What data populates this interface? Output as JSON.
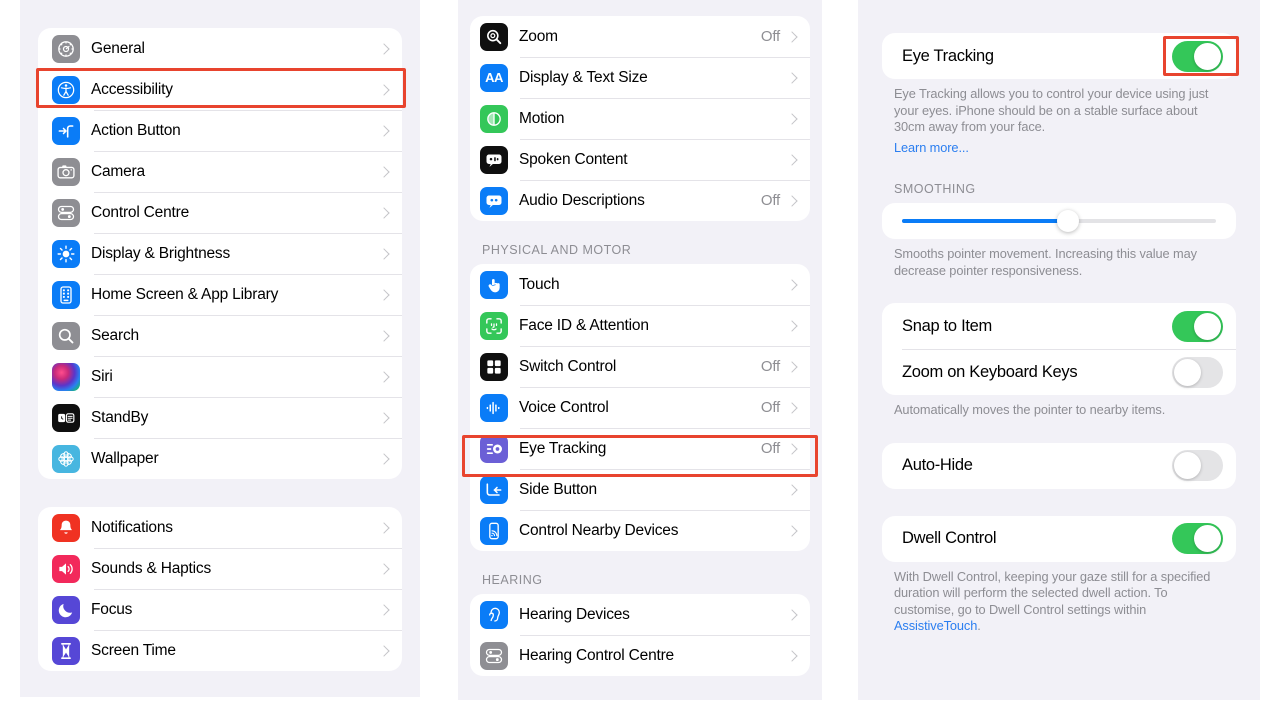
{
  "colors": {
    "highlight": "#e8442e",
    "toggle_on": "#34c759",
    "toggle_off": "#e4e4e6",
    "slider_fill": "#0a7cf7",
    "link": "#2b7ef0",
    "panel_bg": "#f2f1f7"
  },
  "settings_panel": {
    "group1": [
      {
        "label": "General",
        "icon": "gear-icon",
        "value": "",
        "chevron": true
      },
      {
        "label": "Accessibility",
        "icon": "accessibility-icon",
        "value": "",
        "chevron": true,
        "highlighted": true
      },
      {
        "label": "Action Button",
        "icon": "action-button-icon",
        "value": "",
        "chevron": true
      },
      {
        "label": "Camera",
        "icon": "camera-icon",
        "value": "",
        "chevron": true
      },
      {
        "label": "Control Centre",
        "icon": "control-centre-icon",
        "value": "",
        "chevron": true
      },
      {
        "label": "Display & Brightness",
        "icon": "brightness-icon",
        "value": "",
        "chevron": true
      },
      {
        "label": "Home Screen & App Library",
        "icon": "home-screen-icon",
        "value": "",
        "chevron": true
      },
      {
        "label": "Search",
        "icon": "search-icon",
        "value": "",
        "chevron": true
      },
      {
        "label": "Siri",
        "icon": "siri-icon",
        "value": "",
        "chevron": true
      },
      {
        "label": "StandBy",
        "icon": "standby-icon",
        "value": "",
        "chevron": true
      },
      {
        "label": "Wallpaper",
        "icon": "wallpaper-icon",
        "value": "",
        "chevron": true
      }
    ],
    "group2": [
      {
        "label": "Notifications",
        "icon": "notifications-icon",
        "value": "",
        "chevron": true
      },
      {
        "label": "Sounds & Haptics",
        "icon": "sounds-icon",
        "value": "",
        "chevron": true
      },
      {
        "label": "Focus",
        "icon": "focus-icon",
        "value": "",
        "chevron": true
      },
      {
        "label": "Screen Time",
        "icon": "screen-time-icon",
        "value": "",
        "chevron": true
      }
    ]
  },
  "accessibility_panel": {
    "group_vision": [
      {
        "label": "Zoom",
        "icon": "zoom-icon",
        "value": "Off",
        "chevron": true
      },
      {
        "label": "Display & Text Size",
        "icon": "text-size-icon",
        "value": "",
        "chevron": true
      },
      {
        "label": "Motion",
        "icon": "motion-icon",
        "value": "",
        "chevron": true
      },
      {
        "label": "Spoken Content",
        "icon": "spoken-content-icon",
        "value": "",
        "chevron": true
      },
      {
        "label": "Audio Descriptions",
        "icon": "audio-descriptions-icon",
        "value": "Off",
        "chevron": true
      }
    ],
    "section_physical": "PHYSICAL AND MOTOR",
    "group_physical": [
      {
        "label": "Touch",
        "icon": "touch-icon",
        "value": "",
        "chevron": true
      },
      {
        "label": "Face ID & Attention",
        "icon": "face-id-icon",
        "value": "",
        "chevron": true
      },
      {
        "label": "Switch Control",
        "icon": "switch-control-icon",
        "value": "Off",
        "chevron": true
      },
      {
        "label": "Voice Control",
        "icon": "voice-control-icon",
        "value": "Off",
        "chevron": true
      },
      {
        "label": "Eye Tracking",
        "icon": "eye-tracking-icon",
        "value": "Off",
        "chevron": true,
        "highlighted": true
      },
      {
        "label": "Side Button",
        "icon": "side-button-icon",
        "value": "",
        "chevron": true
      },
      {
        "label": "Control Nearby Devices",
        "icon": "nearby-devices-icon",
        "value": "",
        "chevron": true
      }
    ],
    "section_hearing": "HEARING",
    "group_hearing": [
      {
        "label": "Hearing Devices",
        "icon": "hearing-devices-icon",
        "value": "",
        "chevron": true
      },
      {
        "label": "Hearing Control Centre",
        "icon": "hearing-cc-icon",
        "value": "",
        "chevron": true
      }
    ]
  },
  "eye_tracking_panel": {
    "main_toggle": {
      "label": "Eye Tracking",
      "state": "on",
      "highlighted": true
    },
    "description": "Eye Tracking allows you to control your device using just your eyes. iPhone should be on a stable surface about 30cm away from your face.",
    "learn_more": "Learn more...",
    "smoothing_header": "SMOOTHING",
    "smoothing_slider": {
      "percent": 53
    },
    "smoothing_footnote": "Smooths pointer movement. Increasing this value may decrease pointer responsiveness.",
    "pointer_group": [
      {
        "label": "Snap to Item",
        "state": "on"
      },
      {
        "label": "Zoom on Keyboard Keys",
        "state": "off"
      }
    ],
    "pointer_footnote": "Automatically moves the pointer to nearby items.",
    "autohide": {
      "label": "Auto-Hide",
      "state": "off"
    },
    "dwell": {
      "label": "Dwell Control",
      "state": "on"
    },
    "dwell_footnote_pre": "With Dwell Control, keeping your gaze still for a specified duration will perform the selected dwell action. To customise, go to Dwell Control settings within ",
    "dwell_footnote_link": "AssistiveTouch",
    "dwell_footnote_post": "."
  }
}
